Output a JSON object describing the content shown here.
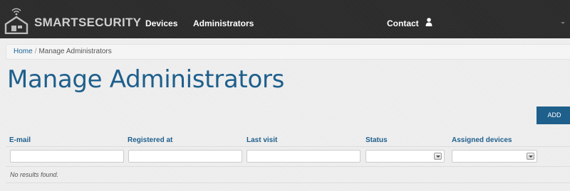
{
  "app": {
    "brand": "SMARTSECURITY"
  },
  "nav": {
    "items": [
      "Devices",
      "Administrators"
    ],
    "contact": "Contact"
  },
  "breadcrumb": {
    "home": "Home",
    "separator": "/",
    "current": "Manage Administrators"
  },
  "page": {
    "title": "Manage Administrators",
    "add_label": "ADD"
  },
  "table": {
    "columns": [
      "E-mail",
      "Registered at",
      "Last visit",
      "Status",
      "Assigned devices"
    ],
    "empty_text": "No results found."
  },
  "icons": {
    "logo": "wifi-house-icon",
    "user": "user-icon",
    "caret": "caret-down-icon"
  },
  "colors": {
    "navbar": "#2b2b2b",
    "accent": "#1e5f8c",
    "link": "#1a6496"
  }
}
